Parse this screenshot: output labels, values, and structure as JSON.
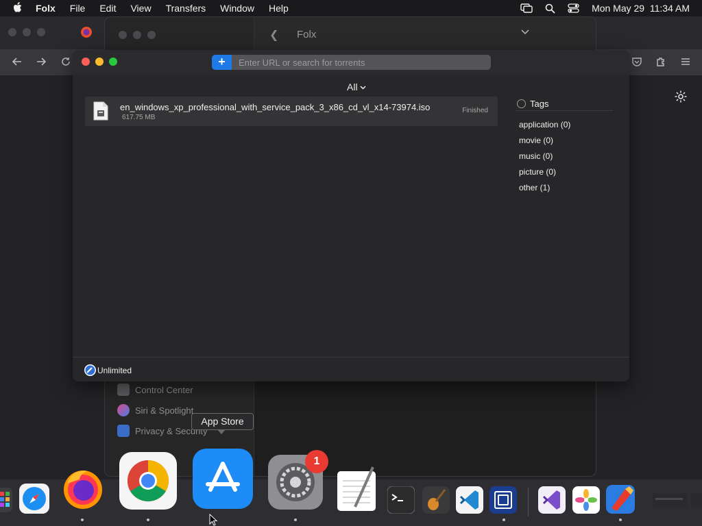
{
  "menubar": {
    "app_name": "Folx",
    "menus": [
      "File",
      "Edit",
      "View",
      "Transfers",
      "Window",
      "Help"
    ],
    "clock": "Mon May 29  11:34 AM"
  },
  "settings_window": {
    "title": "Folx",
    "sidebar": [
      {
        "label": "Control Center",
        "icon": "control-center-icon"
      },
      {
        "label": "Siri & Spotlight",
        "icon": "siri-icon"
      },
      {
        "label": "Privacy & Security",
        "icon": "hand-icon"
      }
    ]
  },
  "folx": {
    "url_placeholder": "Enter URL or search for torrents",
    "add_label": "+",
    "filter_label": "All",
    "tasks": [
      {
        "name": "en_windows_xp_professional_with_service_pack_3_x86_cd_vl_x14-73974.iso",
        "size": "617.75 MB",
        "status": "Finished"
      }
    ],
    "tags_title": "Tags",
    "tags": [
      {
        "label": "application (0)"
      },
      {
        "label": "movie (0)"
      },
      {
        "label": "music (0)"
      },
      {
        "label": "picture (0)"
      },
      {
        "label": "other (1)"
      }
    ],
    "speed_label": "Unlimited"
  },
  "tooltip": "App Store",
  "dock": {
    "items": [
      "launchpad",
      "safari",
      "firefox",
      "chrome",
      "app-store",
      "system-settings",
      "textedit",
      "terminal",
      "garageband",
      "vscode",
      "virtualbox",
      "visual-studio",
      "photos",
      "folx",
      "window-preview"
    ],
    "settings_badge": "1"
  },
  "colors": {
    "accent": "#1f7ae8",
    "window_bg": "#272729",
    "badge": "#ea3b33"
  }
}
